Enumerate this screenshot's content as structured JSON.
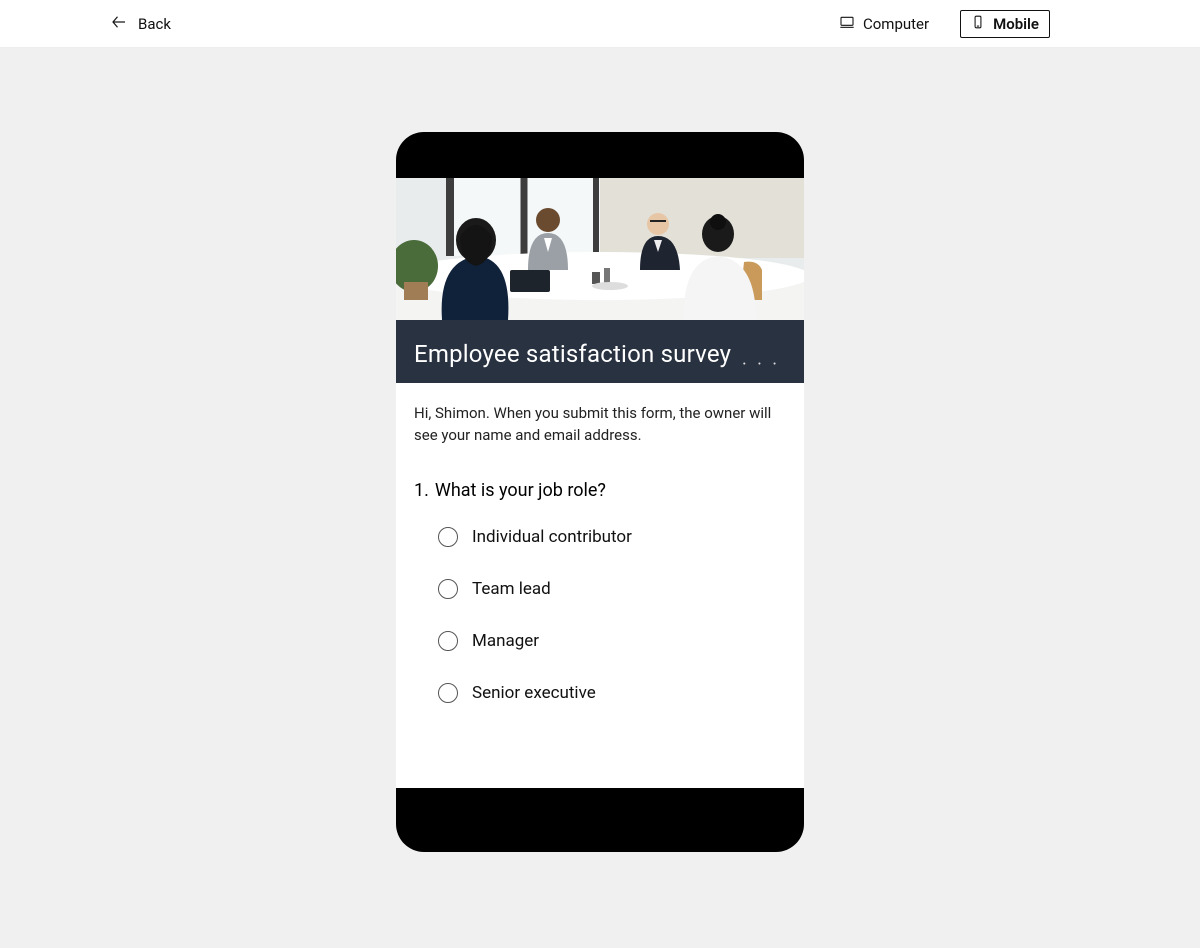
{
  "topbar": {
    "back_label": "Back",
    "computer_label": "Computer",
    "mobile_label": "Mobile"
  },
  "survey": {
    "title": "Employee satisfaction survey",
    "notice": "Hi, Shimon. When you submit this form, the owner will see your name and email address.",
    "question_number": "1.",
    "question_text": "What is your job role?",
    "options": [
      "Individual contributor",
      "Team lead",
      "Manager",
      "Senior executive"
    ]
  }
}
